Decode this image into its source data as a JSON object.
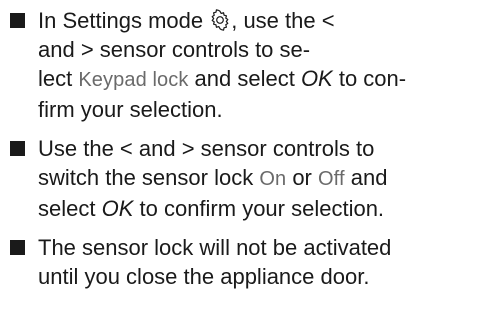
{
  "steps": [
    {
      "lines": [
        [
          "In Settings mode ",
          "gear-icon",
          ", use the <"
        ],
        [
          "and > sensor controls to se-"
        ],
        [
          "lect ",
          "Keypad lock",
          " and select ",
          "OK",
          " to con-"
        ],
        [
          "firm your selection."
        ]
      ],
      "text": {
        "l1a": "In Settings mode ",
        "l1b": ", use the <",
        "l2": "and > sensor controls to se-",
        "l3a": "lect ",
        "l3display": "Keypad lock",
        "l3b": " and select ",
        "l3ok": "OK",
        "l3c": " to con-",
        "l4": "firm your selection."
      }
    },
    {
      "text": {
        "l1": "Use the < and > sensor controls to",
        "l2a": "switch the sensor lock ",
        "l2on": "On",
        "l2b": " or ",
        "l2off": "Off",
        "l2c": " and",
        "l3a": "select ",
        "l3ok": "OK",
        "l3b": " to confirm your selection."
      }
    },
    {
      "text": {
        "l1": "The sensor lock will not be activated",
        "l2": "until you close the appliance door."
      }
    }
  ],
  "icons": {
    "settings": "gear-icon"
  },
  "colors": {
    "text": "#1a1a1a",
    "display_text": "#6a6a6a",
    "bullet": "#1a1a1a"
  }
}
